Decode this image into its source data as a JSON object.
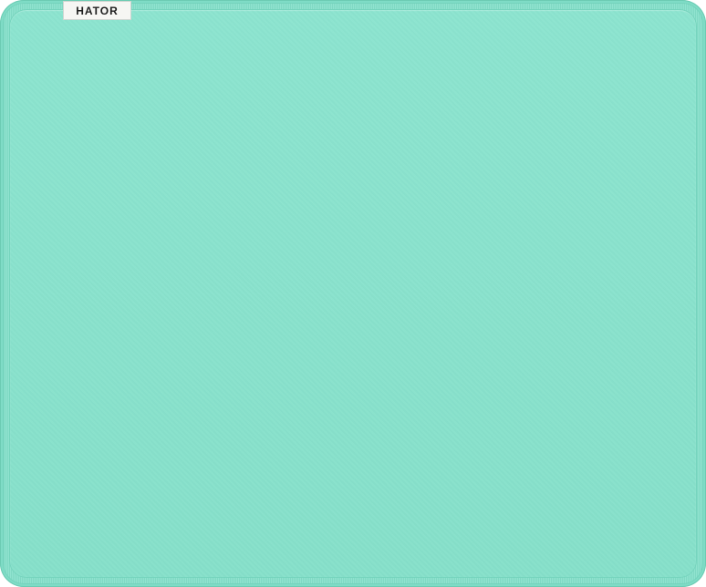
{
  "product": {
    "brand_tag": "HATOR",
    "colors": {
      "pad_outer": "#7fdcc6",
      "pad_surface": "#86e0ca",
      "edge_stitch": "#74d3bc",
      "tag_background": "#f6f6f3",
      "tag_text": "#1f1f1f"
    }
  }
}
